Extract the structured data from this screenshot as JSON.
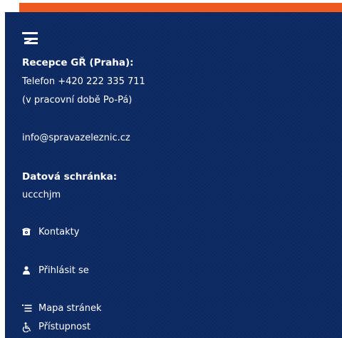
{
  "colors": {
    "accent": "#ed5a1f",
    "footer_bg": "#0d2a63",
    "text": "#ffffff"
  },
  "logo": {
    "icon": "szdc-logo-icon"
  },
  "reception": {
    "heading": "Recepce GŘ (Praha):",
    "phone": "Telefon +420 222 335 711",
    "hours": "(v pracovní době Po-Pá)"
  },
  "email": "info@spravazeleznic.cz",
  "databox": {
    "heading": "Datová schránka:",
    "id": "uccchjm"
  },
  "links": {
    "contacts": {
      "label": "Kontakty",
      "icon": "phone-icon"
    },
    "login": {
      "label": "Přihlásit se",
      "icon": "user-icon"
    },
    "sitemap": {
      "label": "Mapa stránek",
      "icon": "list-icon"
    },
    "accessibility": {
      "label": "Přístupnost",
      "icon": "wheelchair-icon"
    }
  }
}
